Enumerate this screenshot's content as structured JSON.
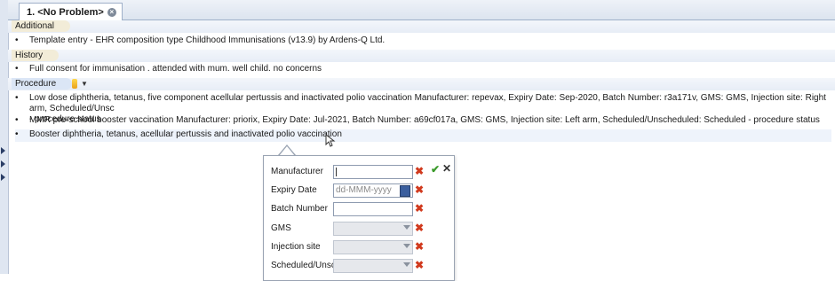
{
  "tab": {
    "label": "1. <No Problem>"
  },
  "sections": [
    {
      "heading": "Additional",
      "entries": [
        {
          "main": "Template entry - EHR composition type",
          "detail": " Childhood Immunisations (v13.9) by Ardens-Q Ltd."
        }
      ]
    },
    {
      "heading": "History",
      "entries": [
        {
          "main": "Full consent for immunisation",
          "detail": " . attended with mum. well child. no concerns"
        }
      ]
    },
    {
      "heading": "Procedure",
      "entries": [
        {
          "main": "Low dose diphtheria, tetanus, five component acellular pertussis and inactivated polio vaccination",
          "detail": " Manufacturer: repevax, Expiry Date: Sep-2020, Batch Number: r3a171v, GMS: GMS, Injection site: Right arm, Scheduled/Unsc",
          "detail2": "- procedure status"
        },
        {
          "main": "MMR pre-school booster vaccination",
          "detail": " Manufacturer: priorix, Expiry Date: Jul-2021, Batch Number: a69cf017a, GMS: GMS, Injection site: Left arm, Scheduled/Unscheduled: Scheduled - procedure status"
        },
        {
          "main": "Booster diphtheria, tetanus, acellular pertussis and inactivated polio vaccination",
          "detail": ""
        }
      ]
    }
  ],
  "popup": {
    "fields": [
      {
        "label": "Manufacturer",
        "value": "",
        "type": "text"
      },
      {
        "label": "Expiry Date",
        "placeholder": "dd-MMM-yyyy",
        "type": "date"
      },
      {
        "label": "Batch Number",
        "value": "",
        "type": "text"
      },
      {
        "label": "GMS",
        "value": "",
        "type": "select"
      },
      {
        "label": "Injection site",
        "value": "",
        "type": "select"
      },
      {
        "label": "Scheduled/Unsc",
        "value": "",
        "type": "select"
      }
    ]
  },
  "icons": {
    "tab_close": "close-circle-icon",
    "ok": "checkmark-icon",
    "close": "close-icon",
    "clear": "red-x-clear-icon",
    "calendar": "calendar-icon",
    "procedure": "lightning-icon",
    "cursor": "mouse-pointer-icon"
  }
}
